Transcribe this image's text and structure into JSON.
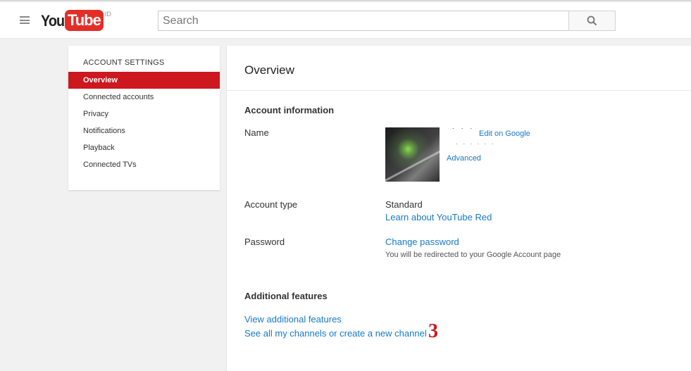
{
  "masthead": {
    "logo_you": "You",
    "logo_tube": "Tube",
    "logo_region": "ID",
    "search_placeholder": "Search"
  },
  "sidebar": {
    "heading": "ACCOUNT SETTINGS",
    "items": [
      {
        "label": "Overview",
        "active": true
      },
      {
        "label": "Connected accounts",
        "active": false
      },
      {
        "label": "Privacy",
        "active": false
      },
      {
        "label": "Notifications",
        "active": false
      },
      {
        "label": "Playback",
        "active": false
      },
      {
        "label": "Connected TVs",
        "active": false
      }
    ]
  },
  "main": {
    "title": "Overview",
    "account_info": {
      "heading": "Account information",
      "name_label": "Name",
      "edit_on_google": "Edit on Google",
      "advanced": "Advanced",
      "account_type_label": "Account type",
      "account_type_value": "Standard",
      "learn_red": "Learn about YouTube Red",
      "password_label": "Password",
      "change_password": "Change password",
      "redirect_note": "You will be redirected to your Google Account page"
    },
    "additional": {
      "heading": "Additional features",
      "view_features": "View additional features",
      "see_channels": "See all my channels or create a new channel"
    },
    "annotation_marker": "3"
  },
  "colors": {
    "brand_red": "#e52d27",
    "active_red": "#cc181e",
    "link_blue": "#167ac6"
  }
}
